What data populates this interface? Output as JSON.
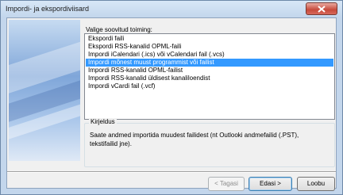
{
  "window": {
    "title": "Impordi- ja ekspordiviisard",
    "close_icon": "close-icon"
  },
  "wizard": {
    "prompt": "Valige soovitud toiming:",
    "actions": [
      {
        "label": "Ekspordi faili",
        "selected": false
      },
      {
        "label": "Ekspordi RSS-kanalid OPML-faili",
        "selected": false
      },
      {
        "label": "Impordi iCalendari (.ics) või vCalendari fail (.vcs)",
        "selected": false
      },
      {
        "label": "Impordi mõnest muust programmist või failist",
        "selected": true
      },
      {
        "label": "Impordi RSS-kanalid OPML-failist",
        "selected": false
      },
      {
        "label": "Impordi RSS-kanalid üldisest kanaliloendist",
        "selected": false
      },
      {
        "label": "Impordi vCardi fail (.vcf)",
        "selected": false
      }
    ],
    "description_title": "Kirjeldus",
    "description_text": "Saate andmed importida muudest failidest (nt Outlooki andmefailid (.PST), tekstifailid jne)."
  },
  "buttons": {
    "back": "< Tagasi",
    "next": "Edasi >",
    "cancel": "Loobu"
  },
  "colors": {
    "selection": "#3399ff",
    "frame": "#c3d6ec"
  }
}
